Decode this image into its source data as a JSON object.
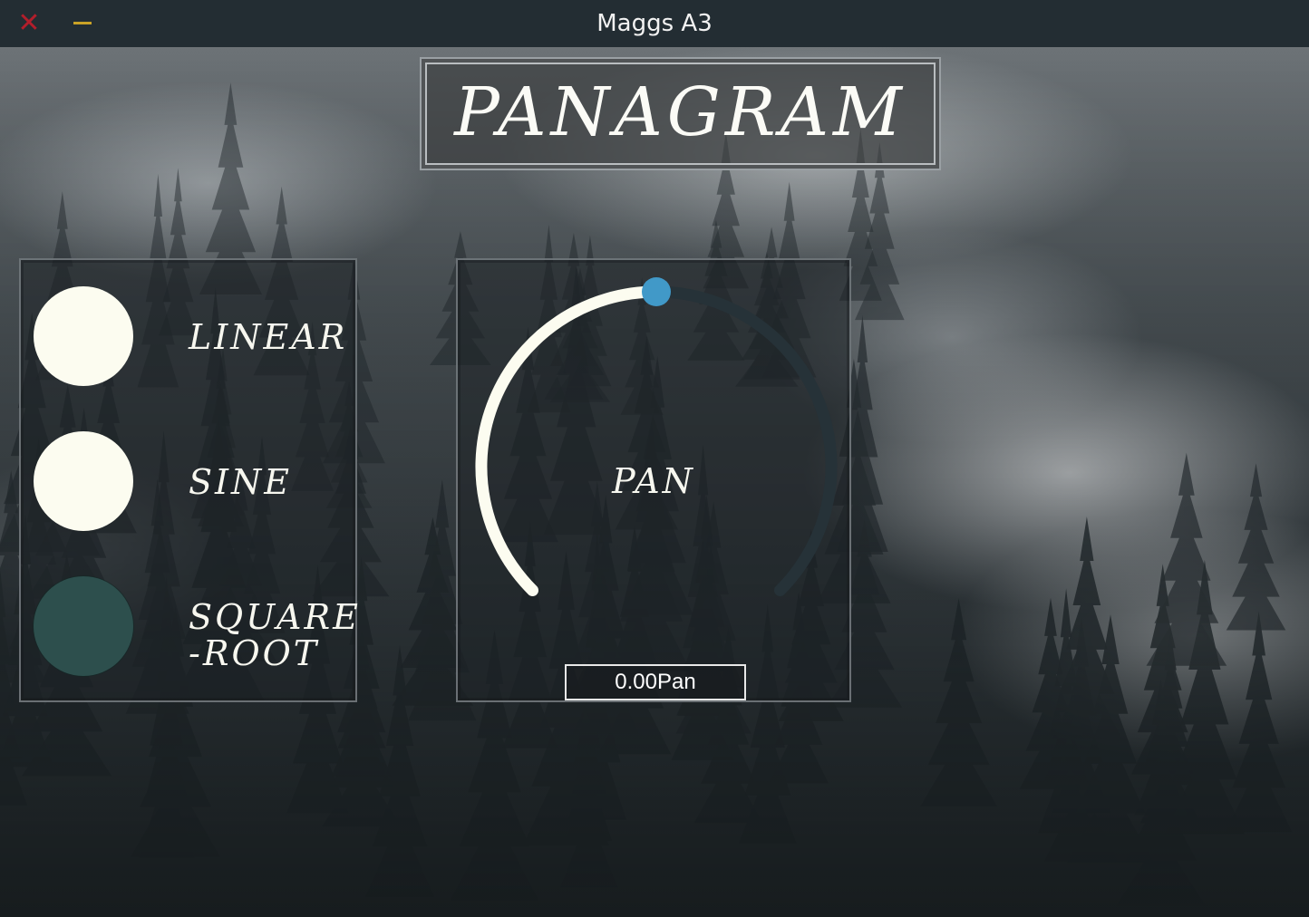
{
  "window": {
    "title": "Maggs A3",
    "close_glyph": "✕",
    "colors": {
      "close": "#b21e2b",
      "minimize": "#c9a227",
      "titlebar": "#232d33"
    }
  },
  "header": {
    "title": "PANAGRAM"
  },
  "pan_law_modes": {
    "items": [
      {
        "label": "LINEAR",
        "selected": false
      },
      {
        "label": "SINE",
        "selected": false
      },
      {
        "label": "SQUARE\n-ROOT",
        "selected": true
      }
    ],
    "colors": {
      "off": "#fcfcf0",
      "on": "#2d4f4d"
    }
  },
  "pan_knob": {
    "label": "PAN",
    "value_text": "0.00Pan",
    "value": 0.0,
    "range": [
      -1,
      1
    ],
    "colors": {
      "active_arc": "#fcfcf0",
      "inactive_arc": "#263238",
      "thumb": "#4199c8"
    }
  }
}
